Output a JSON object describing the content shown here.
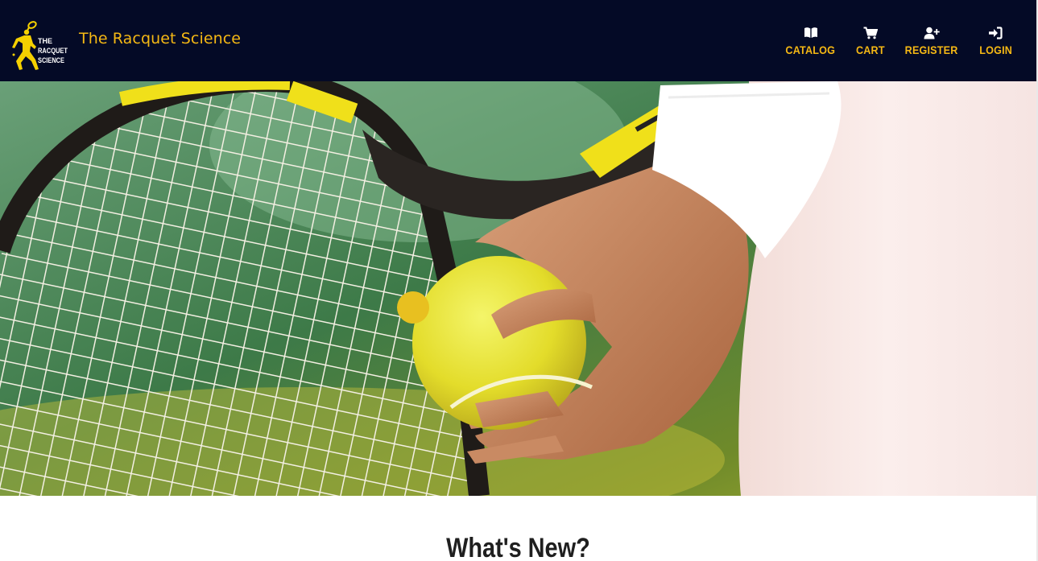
{
  "header": {
    "brand_name": "The Racquet Science",
    "logo": {
      "icon": "tennis-player-logo",
      "lines": [
        "THE",
        "RACQUET",
        "SCIENCE"
      ]
    },
    "nav": [
      {
        "label": "CATALOG",
        "icon": "book-open-icon"
      },
      {
        "label": "CART",
        "icon": "shopping-cart-icon"
      },
      {
        "label": "REGISTER",
        "icon": "user-plus-icon"
      },
      {
        "label": "LOGIN",
        "icon": "sign-in-icon"
      }
    ]
  },
  "hero": {
    "image": "tennis-racquet-and-ball-photo"
  },
  "main": {
    "section_title": "What's New?"
  },
  "colors": {
    "navbar_bg": "#040a26",
    "accent": "#f5b814",
    "page_bg": "#ffffff"
  }
}
